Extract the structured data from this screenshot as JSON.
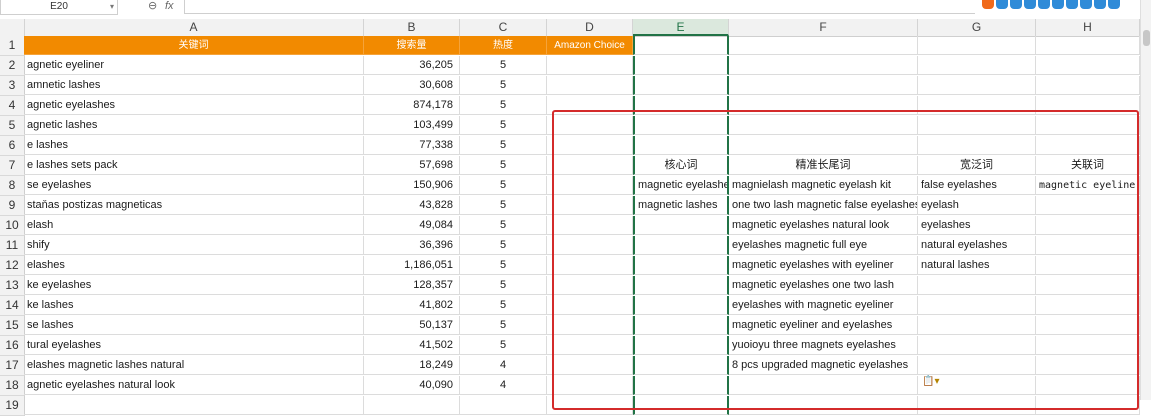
{
  "namebox": {
    "value": "E20",
    "dropdown": "▾"
  },
  "formula_icons": {
    "zoom": "⊖",
    "fx": "fx"
  },
  "tray_colors": [
    "#f06a1b",
    "#2f8bd8",
    "#2f8bd8",
    "#2f8bd8",
    "#2f8bd8",
    "#2f8bd8",
    "#2f8bd8",
    "#2f8bd8",
    "#2f8bd8",
    "#2f8bd8"
  ],
  "columns": [
    "A",
    "B",
    "C",
    "D",
    "E",
    "F",
    "G",
    "H"
  ],
  "row_numbers": [
    "1",
    "2",
    "3",
    "4",
    "5",
    "6",
    "7",
    "8",
    "9",
    "10",
    "11",
    "12",
    "13",
    "14",
    "15",
    "16",
    "17",
    "18",
    "19"
  ],
  "header_row": {
    "a": "关键词",
    "b": "搜索量",
    "c": "热度",
    "d": "Amazon Choice"
  },
  "rows": [
    {
      "a": "agnetic eyeliner",
      "b": "36,205",
      "c": "5",
      "e": "",
      "f": "",
      "g": "",
      "h": ""
    },
    {
      "a": "amnetic lashes",
      "b": "30,608",
      "c": "5",
      "e": "",
      "f": "",
      "g": "",
      "h": ""
    },
    {
      "a": "agnetic eyelashes",
      "b": "874,178",
      "c": "5",
      "e": "",
      "f": "",
      "g": "",
      "h": ""
    },
    {
      "a": "agnetic lashes",
      "b": "103,499",
      "c": "5",
      "e": "",
      "f": "",
      "g": "",
      "h": ""
    },
    {
      "a": "e lashes",
      "b": "77,338",
      "c": "5",
      "e": "",
      "f": "",
      "g": "",
      "h": ""
    },
    {
      "a": "e lashes sets pack",
      "b": "57,698",
      "c": "5",
      "e": "核心词",
      "f": "精准长尾词",
      "g": "宽泛词",
      "h": "关联词"
    },
    {
      "a": "se eyelashes",
      "b": "150,906",
      "c": "5",
      "e": "magnetic eyelashes",
      "f": "magnielash magnetic eyelash kit",
      "g": "false eyelashes",
      "h": "magnetic eyeliner"
    },
    {
      "a": "staňas postizas magneticas",
      "b": "43,828",
      "c": "5",
      "e": "magnetic lashes",
      "f": "one two lash magnetic false eyelashes",
      "g": "eyelash",
      "h": ""
    },
    {
      "a": "elash",
      "b": "49,084",
      "c": "5",
      "e": "",
      "f": "magnetic eyelashes natural look",
      "g": "eyelashes",
      "h": ""
    },
    {
      "a": "shify",
      "b": "36,396",
      "c": "5",
      "e": "",
      "f": "eyelashes magnetic full eye",
      "g": "natural eyelashes",
      "h": ""
    },
    {
      "a": "elashes",
      "b": "1,186,051",
      "c": "5",
      "e": "",
      "f": "magnetic eyelashes with eyeliner",
      "g": "natural lashes",
      "h": ""
    },
    {
      "a": "ke eyelashes",
      "b": "128,357",
      "c": "5",
      "e": "",
      "f": "magnetic eyelashes one two lash",
      "g": "",
      "h": ""
    },
    {
      "a": "ke lashes",
      "b": "41,802",
      "c": "5",
      "e": "",
      "f": "eyelashes with magnetic eyeliner",
      "g": "",
      "h": ""
    },
    {
      "a": "se lashes",
      "b": "50,137",
      "c": "5",
      "e": "",
      "f": "magnetic eyeliner and eyelashes",
      "g": "",
      "h": ""
    },
    {
      "a": "tural eyelashes",
      "b": "41,502",
      "c": "5",
      "e": "",
      "f": "yuoioyu three magnets eyelashes",
      "g": "",
      "h": ""
    },
    {
      "a": "elashes magnetic lashes natural",
      "b": "18,249",
      "c": "4",
      "e": "",
      "f": "8 pcs upgraded magnetic eyelashes",
      "g": "",
      "h": ""
    },
    {
      "a": "agnetic eyelashes natural look",
      "b": "40,090",
      "c": "4",
      "e": "",
      "f": "",
      "g": "",
      "h": ""
    },
    {
      "a": "",
      "b": "",
      "c": "",
      "e": "",
      "f": "",
      "g": "",
      "h": ""
    }
  ],
  "paste_options": "📋▾"
}
